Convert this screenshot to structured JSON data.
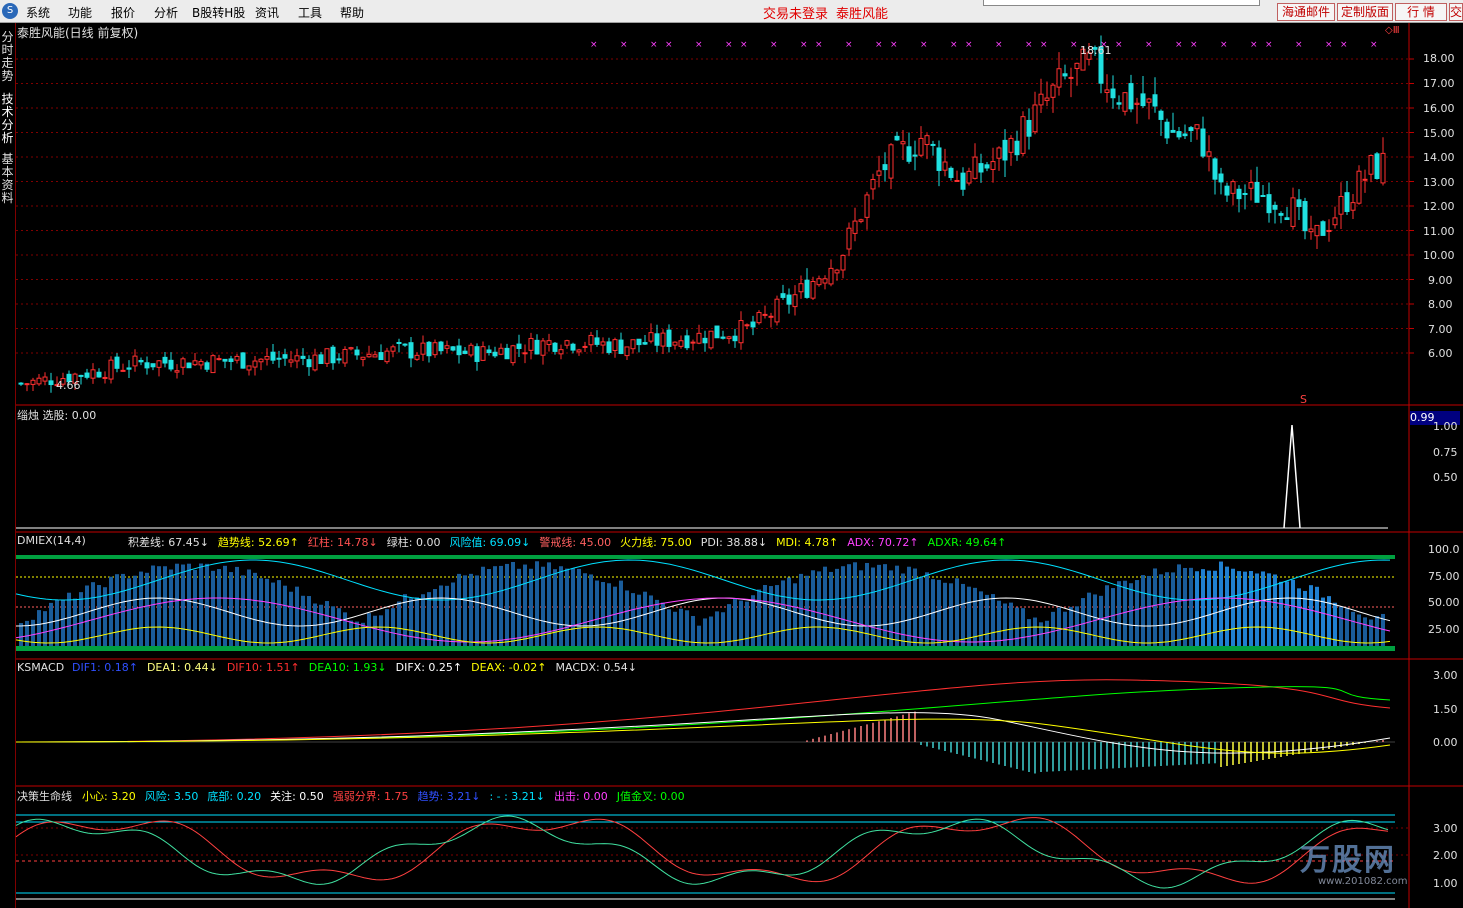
{
  "menu": {
    "logo": "S",
    "items": [
      "系统",
      "功能",
      "报价",
      "分析",
      "B股转H股",
      "资讯",
      "工具",
      "帮助"
    ],
    "center_status": "交易未登录",
    "center_name": "泰胜风能",
    "right_buttons": [
      "海通邮件",
      "定制版面",
      "行  情",
      "交易"
    ]
  },
  "left_tabs": [
    "分时走势",
    "技术分析",
    "基本资料"
  ],
  "price_panel": {
    "title": "泰胜风能(日线 前复权)",
    "high_label": "18.61",
    "low_label": "4.66",
    "y_ticks": [
      "18.00",
      "17.00",
      "16.00",
      "15.00",
      "14.00",
      "13.00",
      "12.00",
      "11.00",
      "10.00",
      "9.00",
      "8.00",
      "7.00",
      "6.00"
    ],
    "marker": "S",
    "corner_icons": "◇Ⅲ"
  },
  "select_panel": {
    "title": "缁烛 选股: 0.00",
    "value_box": "0.99",
    "y_ticks": [
      "1.00",
      "0.75",
      "0.50"
    ]
  },
  "dmi_panel": {
    "name": "DMIEX(14,4)",
    "y_ticks": [
      "100.0",
      "75.00",
      "50.00",
      "25.00"
    ],
    "readouts": [
      {
        "text": "积差线: 67.45↓",
        "color": "#e0e0e0"
      },
      {
        "text": "趋势线: 52.69↑",
        "color": "#ffff00"
      },
      {
        "text": "红柱: 14.78↓",
        "color": "#ff5050"
      },
      {
        "text": "绿柱: 0.00",
        "color": "#e0e0e0"
      },
      {
        "text": "风险值: 69.09↓",
        "color": "#00e0ff"
      },
      {
        "text": "警戒线: 45.00",
        "color": "#ff6060"
      },
      {
        "text": "火力线: 75.00",
        "color": "#ffff00"
      },
      {
        "text": "PDI: 38.88↓",
        "color": "#e0e0e0"
      },
      {
        "text": "MDI: 4.78↑",
        "color": "#ffff00"
      },
      {
        "text": "ADX: 70.72↑",
        "color": "#ff40ff"
      },
      {
        "text": "ADXR: 49.64↑",
        "color": "#00ff00"
      }
    ]
  },
  "macd_panel": {
    "name": "KSMACD",
    "y_ticks": [
      "3.00",
      "1.50",
      "0.00"
    ],
    "readouts": [
      {
        "text": "DIF1: 0.18↑",
        "color": "#3050ff"
      },
      {
        "text": "DEA1: 0.44↓",
        "color": "#ffff80"
      },
      {
        "text": "DIF10: 1.51↑",
        "color": "#ff3030"
      },
      {
        "text": "DEA10: 1.93↓",
        "color": "#00ff00"
      },
      {
        "text": "DIFX: 0.25↑",
        "color": "#ffffff"
      },
      {
        "text": "DEAX: -0.02↑",
        "color": "#ffff00"
      },
      {
        "text": "MACDX: 0.54↓",
        "color": "#e0e0e0"
      }
    ]
  },
  "life_panel": {
    "name": "决策生命线",
    "y_ticks": [
      "3.00",
      "2.00",
      "1.00"
    ],
    "readouts": [
      {
        "text": "小心: 3.20",
        "color": "#ffff00"
      },
      {
        "text": "风险: 3.50",
        "color": "#00e0ff"
      },
      {
        "text": "底部: 0.20",
        "color": "#00e0ff"
      },
      {
        "text": "关注: 0.50",
        "color": "#ffffff"
      },
      {
        "text": "强弱分界: 1.75",
        "color": "#ff4040"
      },
      {
        "text": "趋势: 3.21↓",
        "color": "#3050ff"
      },
      {
        "text": ": - : 3.21↓",
        "color": "#00e0ff"
      },
      {
        "text": "出击: 0.00",
        "color": "#ff40ff"
      },
      {
        "text": "J值金叉: 0.00",
        "color": "#00ff00"
      }
    ]
  },
  "watermark": {
    "text": "万股网",
    "url": "www.201082.com"
  },
  "colors": {
    "up": "#ff3030",
    "down": "#20e0e0",
    "grid": "#800000",
    "axis": "#c00000",
    "text": "#e0e0e0"
  }
}
